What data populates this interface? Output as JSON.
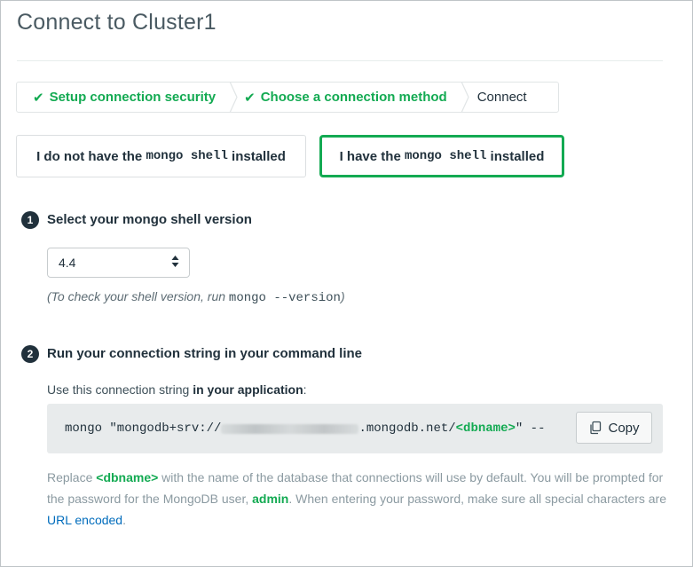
{
  "dialog": {
    "title": "Connect to Cluster1"
  },
  "steps": [
    {
      "label": "Setup connection security",
      "state": "done"
    },
    {
      "label": "Choose a connection method",
      "state": "done"
    },
    {
      "label": "Connect",
      "state": "current"
    }
  ],
  "options": {
    "not_installed": {
      "pre": "I do not have the ",
      "code": "mongo shell",
      "post": " installed"
    },
    "installed": {
      "pre": "I have the ",
      "code": "mongo shell",
      "post": " installed",
      "selected": true
    }
  },
  "section1": {
    "number": "1",
    "title": "Select your mongo shell version",
    "version_value": "4.4",
    "hint_pre": "(To check your shell version, run ",
    "hint_code": "mongo --version",
    "hint_post": ")"
  },
  "section2": {
    "number": "2",
    "title": "Run your connection string in your command line",
    "use_pre": "Use this connection string ",
    "use_bold": "in your application",
    "use_post": ":",
    "conn_pre": "mongo \"mongodb+srv://",
    "conn_mid": ".mongodb.net/",
    "conn_db": "<dbname>",
    "conn_post": "\" --",
    "copy_label": "Copy"
  },
  "note": {
    "p1": "Replace ",
    "dbname": "<dbname>",
    "p2": " with the name of the database that connections will use by default. You will be prompted for the password for the MongoDB user, ",
    "user": "admin",
    "p3": ". When entering your password, make sure all special characters are ",
    "link": "URL encoded",
    "p4": "."
  },
  "colors": {
    "accent_green": "#13aa52",
    "link_blue": "#006cbc",
    "dark": "#21313c"
  },
  "icons": {
    "check": "check-icon",
    "chevron": "chevron-right-icon",
    "sort": "sort-arrows-icon",
    "copy": "copy-icon"
  }
}
